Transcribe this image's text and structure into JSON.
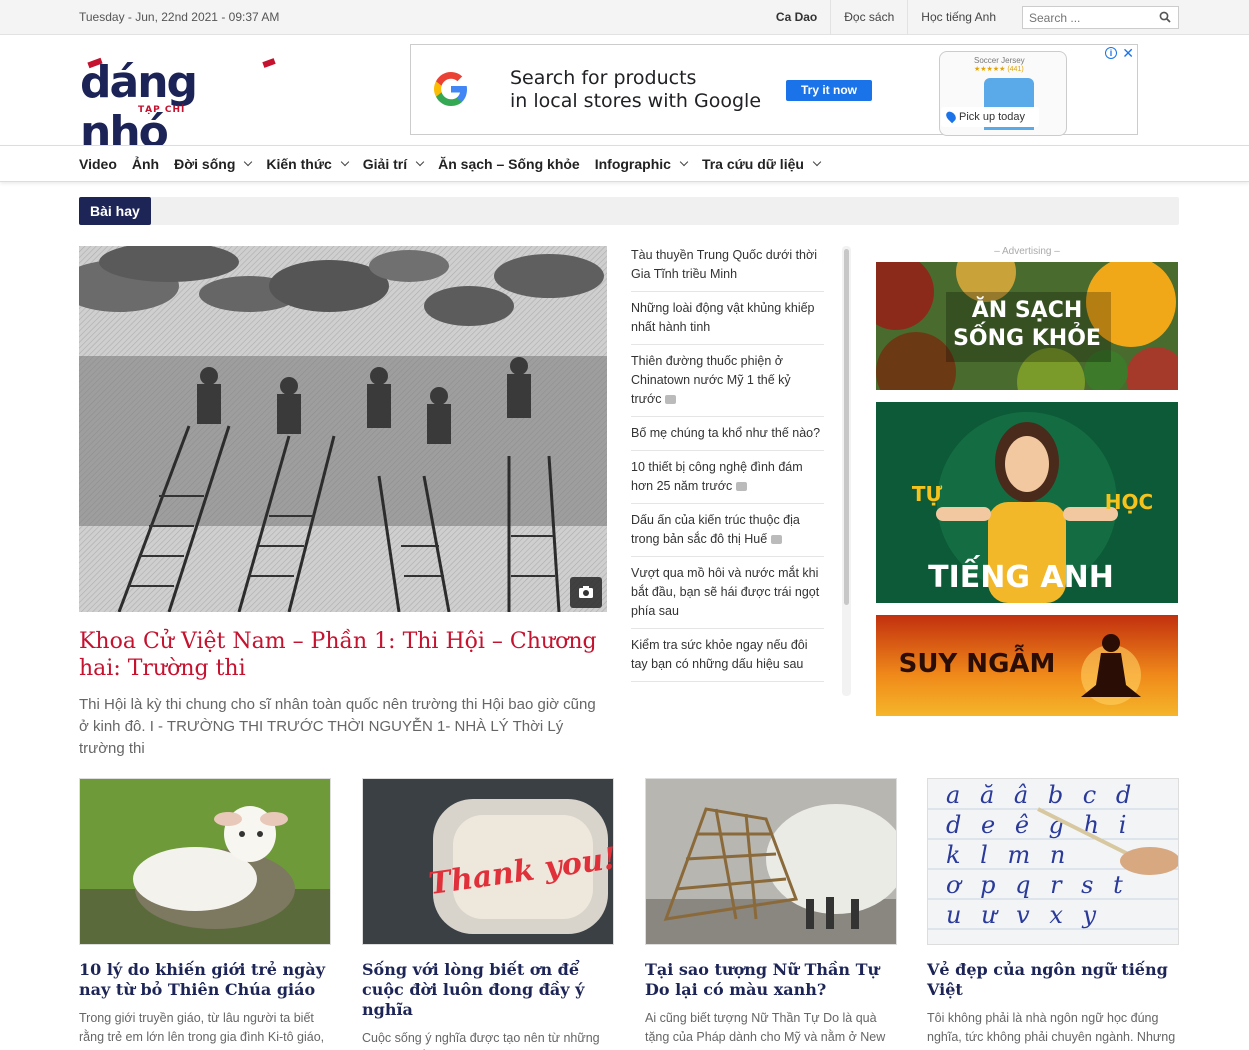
{
  "topbar": {
    "date": "Tuesday - Jun, 22nd 2021 - 09:37 AM",
    "links": [
      "Ca Dao",
      "Đọc sách",
      "Học tiếng Anh"
    ],
    "search_placeholder": "Search ..."
  },
  "logo": {
    "brand": "dáng nhó",
    "sub": "TẠP CHÍ"
  },
  "header_ad": {
    "text_line1": "Search for products",
    "text_line2": "in local stores with Google",
    "cta": "Try it now",
    "product_title": "Soccer Jersey",
    "product_rating": "★★★★★ (441)",
    "pickup": "Pick up today"
  },
  "nav": {
    "items": [
      {
        "label": "Video",
        "dropdown": false
      },
      {
        "label": "Ảnh",
        "dropdown": false
      },
      {
        "label": "Đời sống",
        "dropdown": true
      },
      {
        "label": "Kiến thức",
        "dropdown": true
      },
      {
        "label": "Giải trí",
        "dropdown": true
      },
      {
        "label": "Ăn sạch – Sống khỏe",
        "dropdown": false
      },
      {
        "label": "Infographic",
        "dropdown": true
      },
      {
        "label": "Tra cứu dữ liệu",
        "dropdown": true
      }
    ]
  },
  "section": {
    "label": "Bài hay"
  },
  "featured": {
    "title": "Khoa Cử Việt Nam – Phần 1: Thi Hội – Chương hai: Trường thi",
    "excerpt": "Thi Hội là kỳ thi chung cho sĩ nhân toàn quốc nên trường thi Hội bao giờ cũng ở kinh đô. I - TRƯỜNG THI TRƯỚC THỜI NGUYỄN 1- NHÀ LÝ Thời Lý trường thi"
  },
  "list": [
    {
      "title": "Tàu thuyền Trung Quốc dưới thời Gia Tĩnh triều Minh",
      "photo": false
    },
    {
      "title": "Những loài động vật khủng khiếp nhất hành tinh",
      "photo": false
    },
    {
      "title": "Thiên đường thuốc phiện ở Chinatown nước Mỹ 1 thế kỷ trước",
      "photo": true
    },
    {
      "title": "Bố mẹ chúng ta khổ như thế nào?",
      "photo": false
    },
    {
      "title": "10 thiết bị công nghệ đình đám hơn 25 năm trước",
      "photo": true
    },
    {
      "title": "Dấu ấn của kiến trúc thuộc địa trong bản sắc đô thị Huế",
      "photo": true
    },
    {
      "title": "Vượt qua mồ hôi và nước mắt khi bắt đầu, bạn sẽ hái được trái ngọt phía sau",
      "photo": false
    },
    {
      "title": "Kiểm tra sức khỏe ngay nếu đôi tay bạn có những dấu hiệu sau",
      "photo": false
    }
  ],
  "ads": {
    "label": "– Advertising –",
    "ad1_line1": "ĂN SẠCH",
    "ad1_line2": "SỐNG KHỎE",
    "ad2_word1": "TỰ",
    "ad2_word2": "HỌC",
    "ad2_word3": "TIẾNG ANH",
    "ad3_text": "SUY NGẪM"
  },
  "cards": [
    {
      "title": "10 lý do khiến giới trẻ ngày nay từ bỏ Thiên Chúa giáo",
      "excerpt": "Trong giới truyền giáo, từ lâu người ta biết rằng trẻ em lớn lên trong gia đình Ki-tô giáo,"
    },
    {
      "title": "Sống với lòng biết ơn để cuộc đời luôn đong đầy ý nghĩa",
      "excerpt": "Cuộc sống ý nghĩa được tạo nên từ những khoảnh khắc vô giá của việc “cho đi” và"
    },
    {
      "title": "Tại sao tượng Nữ Thần Tự Do lại có màu xanh?",
      "excerpt": "Ai cũng biết tượng Nữ Thần Tự Do là quà tặng của Pháp dành cho Mỹ và nằm ở New"
    },
    {
      "title": "Vẻ đẹp của ngôn ngữ tiếng Việt",
      "excerpt": "Tôi không phải là nhà ngôn ngữ học đúng nghĩa, tức không phải chuyên ngành. Nhưng tôi lâu lâu có làm thơ và thỉnh"
    }
  ],
  "card4_letters": [
    "a ă â b c d",
    "d e ê g h i",
    "k l m n",
    "ơ p q r s t",
    "u ư v x y"
  ],
  "card2_sign": "Thank you!",
  "colors": {
    "brand_navy": "#1d2557",
    "accent_red": "#c4122f",
    "ad_blue": "#1a73e8"
  }
}
